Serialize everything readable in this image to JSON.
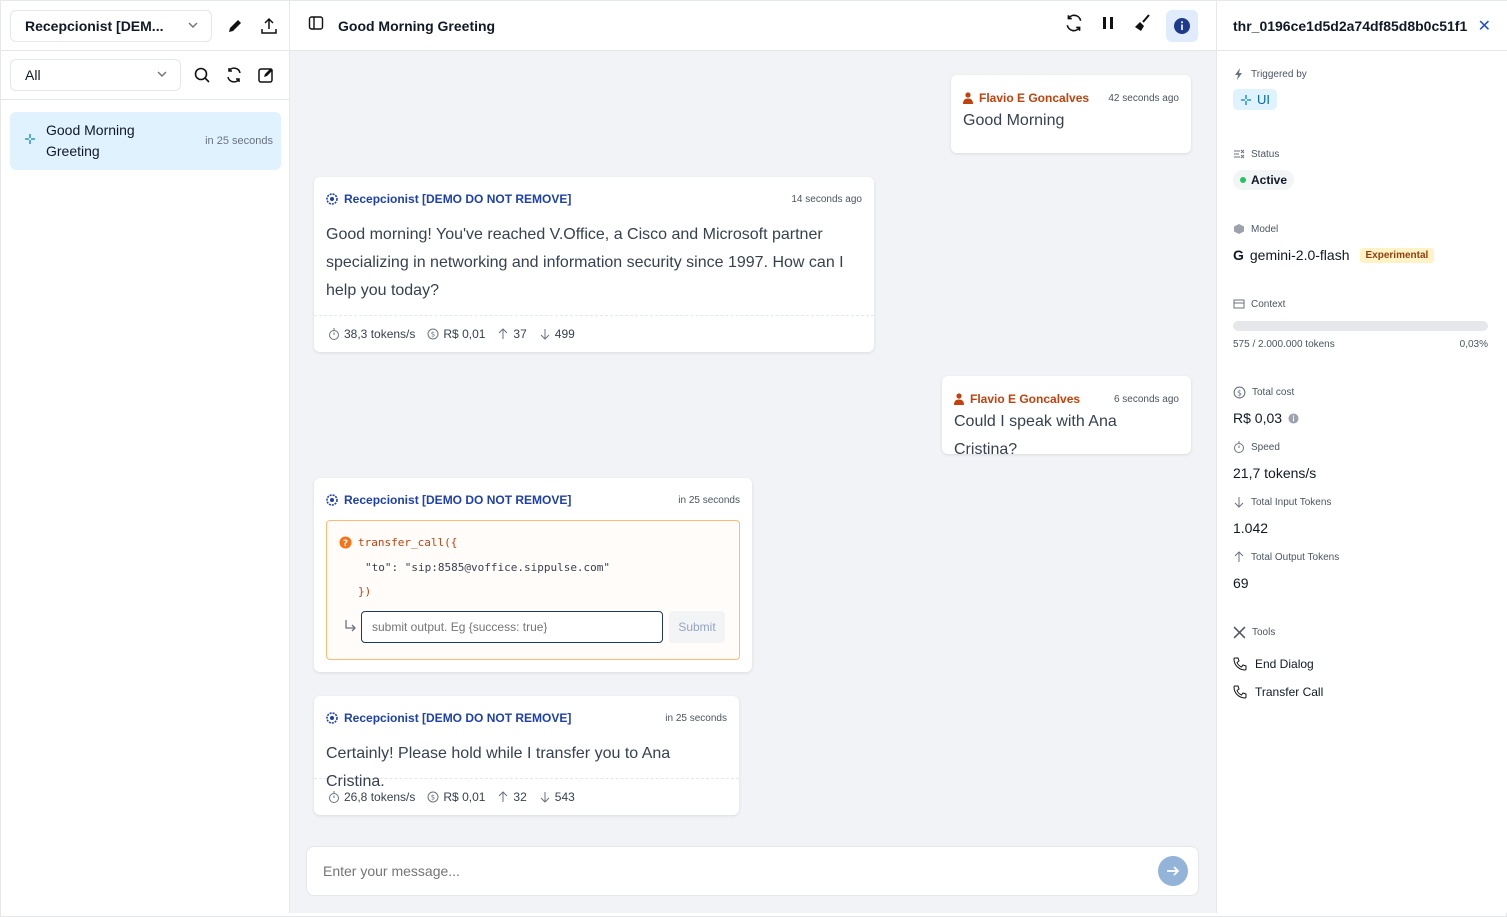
{
  "sidebar": {
    "agent_name": "Recepcionist [DEM...",
    "filter_value": "All",
    "threads": [
      {
        "title": "Good Morning Greeting",
        "time": "in 25 seconds"
      }
    ]
  },
  "main": {
    "title": "Good Morning Greeting",
    "messages": [
      {
        "author": "Flavio E Goncalves",
        "time": "42 seconds ago",
        "text": "Good Morning"
      },
      {
        "author": "Recepcionist [DEMO DO NOT REMOVE]",
        "time": "14 seconds ago",
        "text": "Good morning! You've reached V.Office, a Cisco and Microsoft partner specializing in networking and information security since 1997. How can I help you today?",
        "speed": "38,3 tokens/s",
        "cost": "R$ 0,01",
        "up": "37",
        "down": "499"
      },
      {
        "author": "Flavio E Goncalves",
        "time": "6 seconds ago",
        "text": "Could I speak with Ana Cristina?"
      },
      {
        "author": "Recepcionist [DEMO DO NOT REMOVE]",
        "time": "in 25 seconds",
        "tool_line1": "transfer_call({",
        "tool_line2_key": "\"to\"",
        "tool_line2_sep": ": ",
        "tool_line2_val": "\"sip:8585@voffice.sippulse.com\"",
        "tool_line3": "})",
        "output_placeholder": "submit output. Eg {success: true}",
        "submit_label": "Submit"
      },
      {
        "author": "Recepcionist [DEMO DO NOT REMOVE]",
        "time": "in 25 seconds",
        "text": "Certainly! Please hold while I transfer you to Ana Cristina.",
        "speed": "26,8 tokens/s",
        "cost": "R$ 0,01",
        "up": "32",
        "down": "543"
      }
    ],
    "composer_placeholder": "Enter your message..."
  },
  "details": {
    "thread_id": "thr_0196ce1d5d2a74df85d8b0c51f1",
    "close": "✕",
    "triggered_label": "Triggered by",
    "triggered_value": "UI",
    "status_label": "Status",
    "status_value": "Active",
    "model_label": "Model",
    "model_value": "gemini-2.0-flash",
    "model_badge": "Experimental",
    "context_label": "Context",
    "context_fraction": 0.0003,
    "context_tokens": "575 / 2.000.000 tokens",
    "context_percent": "0,03%",
    "total_cost_label": "Total cost",
    "total_cost_value": "R$ 0,03",
    "speed_label": "Speed",
    "speed_value": "21,7 tokens/s",
    "input_label": "Total Input Tokens",
    "input_value": "1.042",
    "output_label": "Total Output Tokens",
    "output_value": "69",
    "tools_label": "Tools",
    "tools": [
      "End Dialog",
      "Transfer Call"
    ]
  },
  "colors": {
    "user": "#c2410c",
    "bot": "#1e40af",
    "accent": "#1d4ed8",
    "active_dot": "#22c55e"
  }
}
